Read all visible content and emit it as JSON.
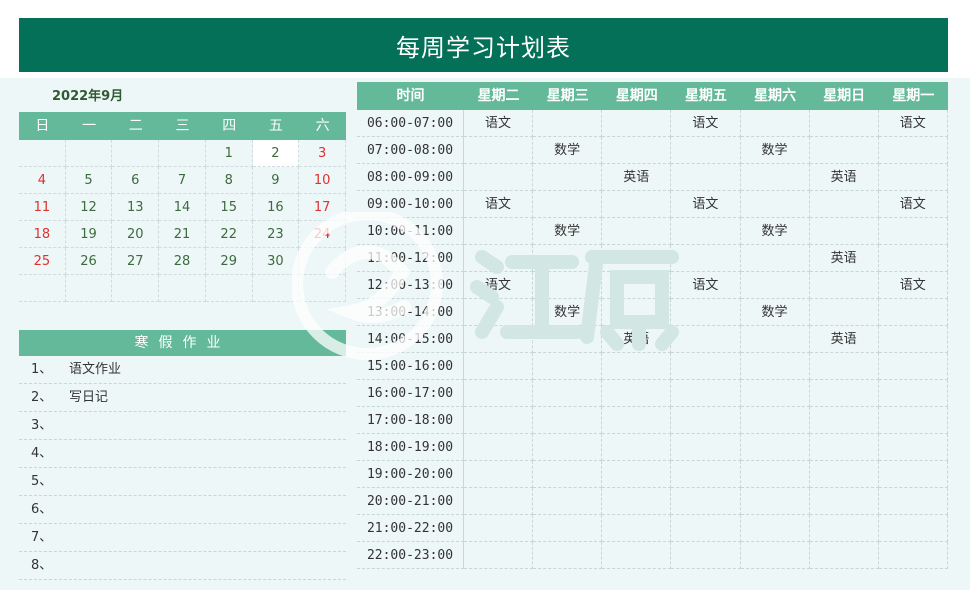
{
  "title": "每周学习计划表",
  "calendar": {
    "month": "2022年9月",
    "weekdays": [
      "日",
      "一",
      "二",
      "三",
      "四",
      "五",
      "六"
    ],
    "rows": [
      [
        "",
        "",
        "",
        "",
        "1",
        "2",
        "3"
      ],
      [
        "4",
        "5",
        "6",
        "7",
        "8",
        "9",
        "10"
      ],
      [
        "11",
        "12",
        "13",
        "14",
        "15",
        "16",
        "17"
      ],
      [
        "18",
        "19",
        "20",
        "21",
        "22",
        "23",
        "24"
      ],
      [
        "25",
        "26",
        "27",
        "28",
        "29",
        "30",
        ""
      ],
      [
        "",
        "",
        "",
        "",
        "",
        "",
        ""
      ]
    ],
    "weekend_color": "#e0302f",
    "today": "2"
  },
  "homework": {
    "title": "寒假作业",
    "items": [
      {
        "num": "1、",
        "text": "语文作业"
      },
      {
        "num": "2、",
        "text": "写日记"
      },
      {
        "num": "3、",
        "text": ""
      },
      {
        "num": "4、",
        "text": ""
      },
      {
        "num": "5、",
        "text": ""
      },
      {
        "num": "6、",
        "text": ""
      },
      {
        "num": "7、",
        "text": ""
      },
      {
        "num": "8、",
        "text": ""
      }
    ]
  },
  "schedule": {
    "headers": [
      "时间",
      "星期二",
      "星期三",
      "星期四",
      "星期五",
      "星期六",
      "星期日",
      "星期一"
    ],
    "rows": [
      {
        "time": "06:00-07:00",
        "cells": [
          "语文",
          "",
          "",
          "语文",
          "",
          "",
          "语文"
        ]
      },
      {
        "time": "07:00-08:00",
        "cells": [
          "",
          "数学",
          "",
          "",
          "数学",
          "",
          ""
        ]
      },
      {
        "time": "08:00-09:00",
        "cells": [
          "",
          "",
          "英语",
          "",
          "",
          "英语",
          ""
        ]
      },
      {
        "time": "09:00-10:00",
        "cells": [
          "语文",
          "",
          "",
          "语文",
          "",
          "",
          "语文"
        ]
      },
      {
        "time": "10:00-11:00",
        "cells": [
          "",
          "数学",
          "",
          "",
          "数学",
          "",
          ""
        ]
      },
      {
        "time": "11:00-12:00",
        "cells": [
          "",
          "",
          "英语",
          "",
          "",
          "英语",
          ""
        ]
      },
      {
        "time": "12:00-13:00",
        "cells": [
          "语文",
          "",
          "",
          "语文",
          "",
          "",
          "语文"
        ]
      },
      {
        "time": "13:00-14:00",
        "cells": [
          "",
          "数学",
          "",
          "",
          "数学",
          "",
          ""
        ]
      },
      {
        "time": "14:00-15:00",
        "cells": [
          "",
          "",
          "英语",
          "",
          "",
          "英语",
          ""
        ]
      },
      {
        "time": "15:00-16:00",
        "cells": [
          "",
          "",
          "",
          "",
          "",
          "",
          ""
        ]
      },
      {
        "time": "16:00-17:00",
        "cells": [
          "",
          "",
          "",
          "",
          "",
          "",
          ""
        ]
      },
      {
        "time": "17:00-18:00",
        "cells": [
          "",
          "",
          "",
          "",
          "",
          "",
          ""
        ]
      },
      {
        "time": "18:00-19:00",
        "cells": [
          "",
          "",
          "",
          "",
          "",
          "",
          ""
        ]
      },
      {
        "time": "19:00-20:00",
        "cells": [
          "",
          "",
          "",
          "",
          "",
          "",
          ""
        ]
      },
      {
        "time": "20:00-21:00",
        "cells": [
          "",
          "",
          "",
          "",
          "",
          "",
          ""
        ]
      },
      {
        "time": "21:00-22:00",
        "cells": [
          "",
          "",
          "",
          "",
          "",
          "",
          ""
        ]
      },
      {
        "time": "22:00-23:00",
        "cells": [
          "",
          "",
          "",
          "",
          "",
          "",
          ""
        ]
      }
    ]
  },
  "colors": {
    "title_bg": "#037057",
    "header_bg": "#63b99a",
    "panel_bg": "#eef7f7"
  },
  "watermark": {
    "text": "江源"
  }
}
